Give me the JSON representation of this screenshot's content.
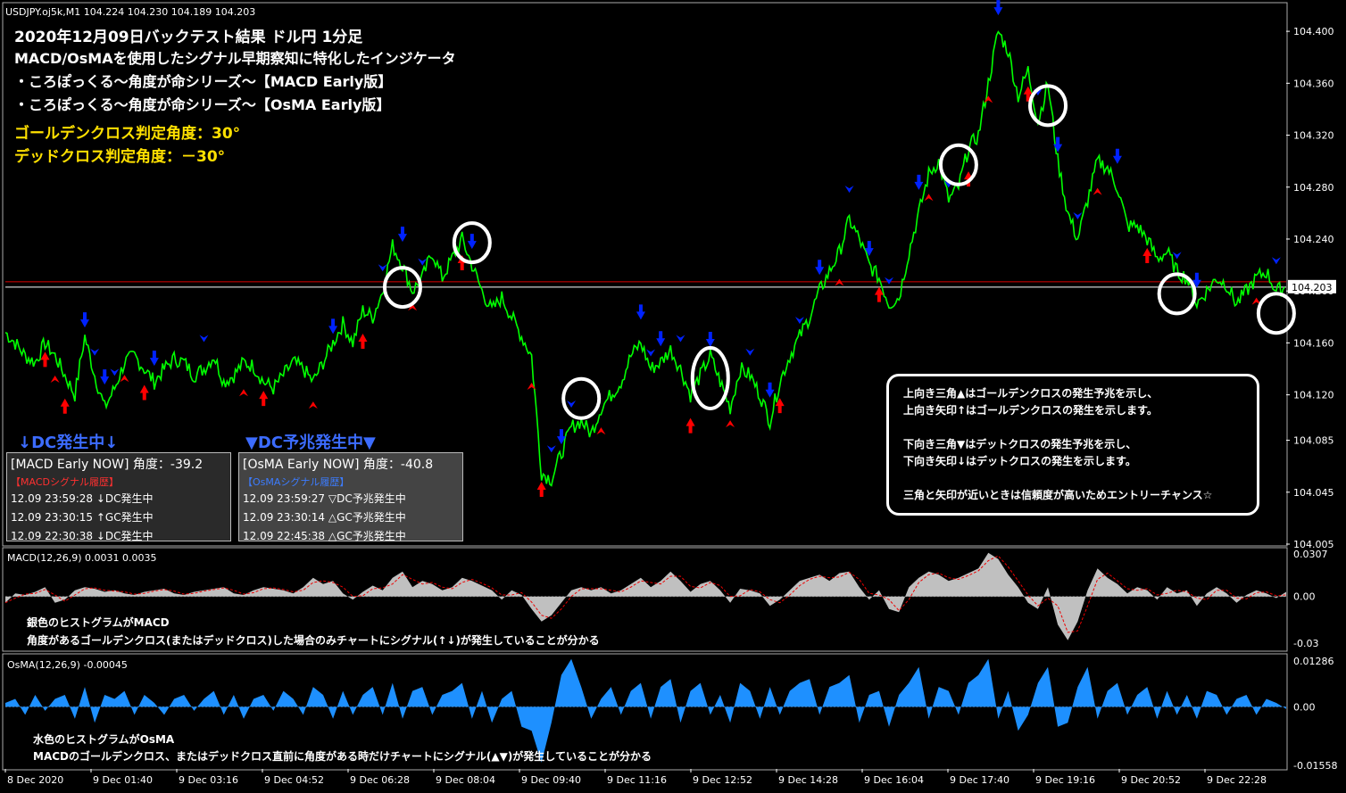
{
  "header": {
    "symbol_info": "USDJPY.oj5k,M1  104.224 104.230 104.189 104.203"
  },
  "titles": {
    "line1": "2020年12月09日バックテスト結果 ドル円 1分足",
    "line2": "MACD/OsMAを使用したシグナル早期察知に特化したインジケータ",
    "line3": "・ころぽっくる～角度が命シリーズ～【MACD Early版】",
    "line4": "・ころぽっくる～角度が命シリーズ～【OsMA Early版】",
    "gc_angle": "ゴールデンクロス判定角度：30°",
    "dc_angle": "デッドクロス判定角度：－30°"
  },
  "macd_panel": {
    "status": "↓DC発生中↓",
    "head": "[MACD Early NOW] 角度：-39.2",
    "sub": "【MACDシグナル履歴】",
    "rows": [
      "12.09 23:59:28 ↓DC発生中",
      "12.09 23:30:15 ↑GC発生中",
      "12.09 22:30:38 ↓DC発生中"
    ]
  },
  "osma_panel": {
    "status": "▼DC予兆発生中▼",
    "head": "[OsMA Early NOW] 角度：-40.8",
    "sub": "【OsMAシグナル履歴】",
    "rows": [
      "12.09 23:59:27 ▽DC予兆発生中",
      "12.09 23:30:14 △GC予兆発生中",
      "12.09 22:45:38 △GC予兆発生中"
    ]
  },
  "legend": {
    "l1": "上向き三角▲はゴールデンクロスの発生予兆を示し、",
    "l2": "上向き矢印↑はゴールデンクロスの発生を示します。",
    "l3": "下向き三角▼はデットクロスの発生予兆を示し、",
    "l4": "下向き矢印↓はデットクロスの発生を示します。",
    "l5": "三角と矢印が近いときは信頼度が高いためエントリーチャンス☆"
  },
  "macd_notes": {
    "n1": "銀色のヒストグラムがMACD",
    "n2": "角度があるゴールデンクロス(またはデッドクロス)した場合のみチャートにシグナル(↑↓)が発生していることが分かる"
  },
  "osma_notes": {
    "n1": "水色のヒストグラムがOsMA",
    "n2": "MACDのゴールデンクロス、またはデッドクロス直前に角度がある時だけチャートにシグナル(▲▼)が発生していることが分かる"
  },
  "colors": {
    "price": "#00ff00",
    "buy": "#ff0000",
    "sell": "#0022ff",
    "macd_hist": "#c0c0c0",
    "osma_hist": "#1e90ff",
    "grid": "#ffffff"
  },
  "chart_data": [
    {
      "type": "line",
      "title": "USDJPY.oj5k,M1",
      "x": [
        "8 Dec 2020",
        "9 Dec 01:40",
        "9 Dec 03:16",
        "9 Dec 04:52",
        "9 Dec 06:28",
        "9 Dec 08:04",
        "9 Dec 09:40",
        "9 Dec 11:16",
        "9 Dec 12:52",
        "9 Dec 14:28",
        "9 Dec 16:04",
        "9 Dec 17:40",
        "9 Dec 19:16",
        "9 Dec 20:52",
        "9 Dec 22:28"
      ],
      "yticks": [
        104.4,
        104.36,
        104.32,
        104.28,
        104.24,
        104.2,
        104.16,
        104.12,
        104.085,
        104.045,
        104.005
      ],
      "ylim": [
        104.005,
        104.42
      ],
      "current_price": 104.203,
      "series": [
        {
          "values": [
            104.168,
            104.16,
            104.15,
            104.145,
            104.16,
            104.15,
            104.135,
            104.12,
            104.165,
            104.135,
            104.11,
            104.125,
            104.145,
            104.15,
            104.14,
            104.13,
            104.14,
            104.148,
            104.145,
            104.135,
            104.14,
            104.15,
            104.13,
            104.135,
            104.145,
            104.142,
            104.13,
            104.125,
            104.135,
            104.145,
            104.14,
            104.13,
            104.145,
            104.16,
            104.175,
            104.16,
            104.185,
            104.18,
            104.2,
            104.235,
            104.22,
            104.2,
            104.21,
            104.23,
            104.21,
            104.225,
            104.24,
            104.22,
            104.2,
            104.185,
            104.195,
            104.18,
            104.165,
            104.15,
            104.06,
            104.055,
            104.075,
            104.095,
            104.1,
            104.09,
            104.11,
            104.12,
            104.13,
            104.15,
            104.16,
            104.14,
            104.145,
            104.155,
            104.14,
            104.12,
            104.135,
            104.15,
            104.13,
            104.11,
            104.14,
            104.135,
            104.12,
            104.1,
            104.13,
            104.15,
            104.165,
            104.18,
            104.2,
            104.215,
            104.23,
            104.255,
            104.24,
            104.22,
            104.21,
            104.19,
            104.195,
            104.23,
            104.26,
            104.29,
            104.3,
            104.27,
            104.28,
            104.31,
            104.32,
            104.36,
            104.4,
            104.385,
            104.35,
            104.37,
            104.33,
            104.36,
            104.3,
            104.26,
            104.24,
            104.27,
            104.3,
            104.295,
            104.28,
            104.25,
            104.25,
            104.24,
            104.225,
            104.23,
            104.215,
            104.21,
            104.19,
            104.2,
            104.21,
            104.205,
            104.19,
            104.2,
            104.21,
            104.215,
            104.2,
            104.203
          ]
        }
      ]
    },
    {
      "type": "area",
      "title": "MACD(12,26,9) 0.0031 0.0035",
      "yticks": [
        0.0307,
        0.0,
        -0.03
      ],
      "ylim": [
        -0.035,
        0.0307
      ],
      "series": [
        {
          "name": "MACD",
          "values": [
            -0.004,
            0.002,
            0.001,
            0.003,
            0.006,
            -0.004,
            -0.002,
            0.004,
            0.006,
            0.005,
            0.003,
            0.004,
            0.002,
            0.001,
            0.003,
            0.004,
            0.005,
            0.002,
            0.001,
            0.003,
            0.004,
            0.005,
            0.006,
            0.002,
            0.001,
            0.004,
            0.006,
            0.005,
            0.004,
            0.002,
            0.006,
            0.012,
            0.008,
            0.01,
            0.002,
            -0.002,
            0.003,
            0.007,
            0.004,
            0.012,
            0.016,
            0.006,
            0.01,
            0.008,
            0.004,
            0.006,
            0.012,
            0.01,
            0.007,
            0.004,
            -0.002,
            0.004,
            0.001,
            -0.008,
            -0.016,
            -0.012,
            -0.004,
            0.004,
            0.006,
            0.004,
            0.006,
            0.002,
            0.004,
            0.008,
            0.012,
            0.006,
            0.01,
            0.016,
            0.01,
            0.003,
            0.008,
            0.01,
            0.004,
            -0.004,
            0.005,
            0.004,
            0.002,
            -0.006,
            -0.002,
            0.004,
            0.01,
            0.012,
            0.014,
            0.01,
            0.015,
            0.016,
            0.006,
            -0.002,
            0.004,
            -0.008,
            -0.01,
            0.006,
            0.012,
            0.016,
            0.014,
            0.01,
            0.012,
            0.015,
            0.018,
            0.028,
            0.024,
            0.014,
            0.006,
            -0.004,
            -0.008,
            0.006,
            -0.018,
            -0.028,
            -0.016,
            0.004,
            0.018,
            0.012,
            0.008,
            0.002,
            0.006,
            0.004,
            -0.002,
            0.006,
            0.002,
            0.004,
            -0.006,
            0.002,
            0.006,
            0.002,
            -0.004,
            0.001,
            0.004,
            0.002,
            -0.001,
            0.003
          ]
        }
      ]
    },
    {
      "type": "area",
      "title": "OsMA(12,26,9) -0.00045",
      "yticks": [
        0.01286,
        0.0,
        -0.01558
      ],
      "ylim": [
        -0.01558,
        0.01286
      ],
      "series": [
        {
          "name": "OsMA",
          "values": [
            0.001,
            0.002,
            -0.002,
            0.003,
            -0.001,
            0.002,
            0.003,
            -0.003,
            0.005,
            -0.004,
            0.003,
            0.002,
            0.004,
            -0.002,
            0.003,
            0.001,
            -0.002,
            0.002,
            0.003,
            -0.001,
            0.002,
            0.004,
            -0.002,
            0.003,
            -0.003,
            0.002,
            0.003,
            -0.001,
            0.004,
            0.002,
            -0.002,
            0.005,
            0.003,
            -0.003,
            0.004,
            -0.002,
            0.003,
            0.005,
            -0.002,
            0.006,
            -0.003,
            0.004,
            0.005,
            -0.002,
            0.003,
            0.004,
            0.006,
            -0.003,
            0.004,
            -0.004,
            0.002,
            0.004,
            -0.005,
            -0.006,
            -0.014,
            -0.004,
            0.008,
            0.012,
            0.005,
            -0.003,
            0.002,
            0.005,
            -0.002,
            0.004,
            0.006,
            -0.003,
            0.005,
            0.007,
            -0.004,
            0.004,
            0.006,
            -0.002,
            0.003,
            -0.004,
            0.006,
            0.004,
            -0.003,
            0.005,
            -0.002,
            0.004,
            0.006,
            0.007,
            -0.002,
            0.005,
            0.006,
            0.008,
            -0.004,
            0.003,
            0.004,
            -0.005,
            0.003,
            0.006,
            0.01,
            -0.003,
            0.005,
            0.004,
            -0.002,
            0.006,
            0.008,
            0.012,
            -0.003,
            0.004,
            -0.006,
            -0.002,
            0.006,
            0.01,
            -0.005,
            -0.004,
            0.005,
            0.01,
            -0.003,
            0.004,
            0.006,
            -0.002,
            0.003,
            0.005,
            -0.003,
            0.004,
            -0.002,
            0.003,
            -0.003,
            0.004,
            0.003,
            -0.002,
            0.002,
            0.003,
            -0.002,
            0.002,
            0.001,
            -0.0005
          ]
        }
      ]
    }
  ]
}
